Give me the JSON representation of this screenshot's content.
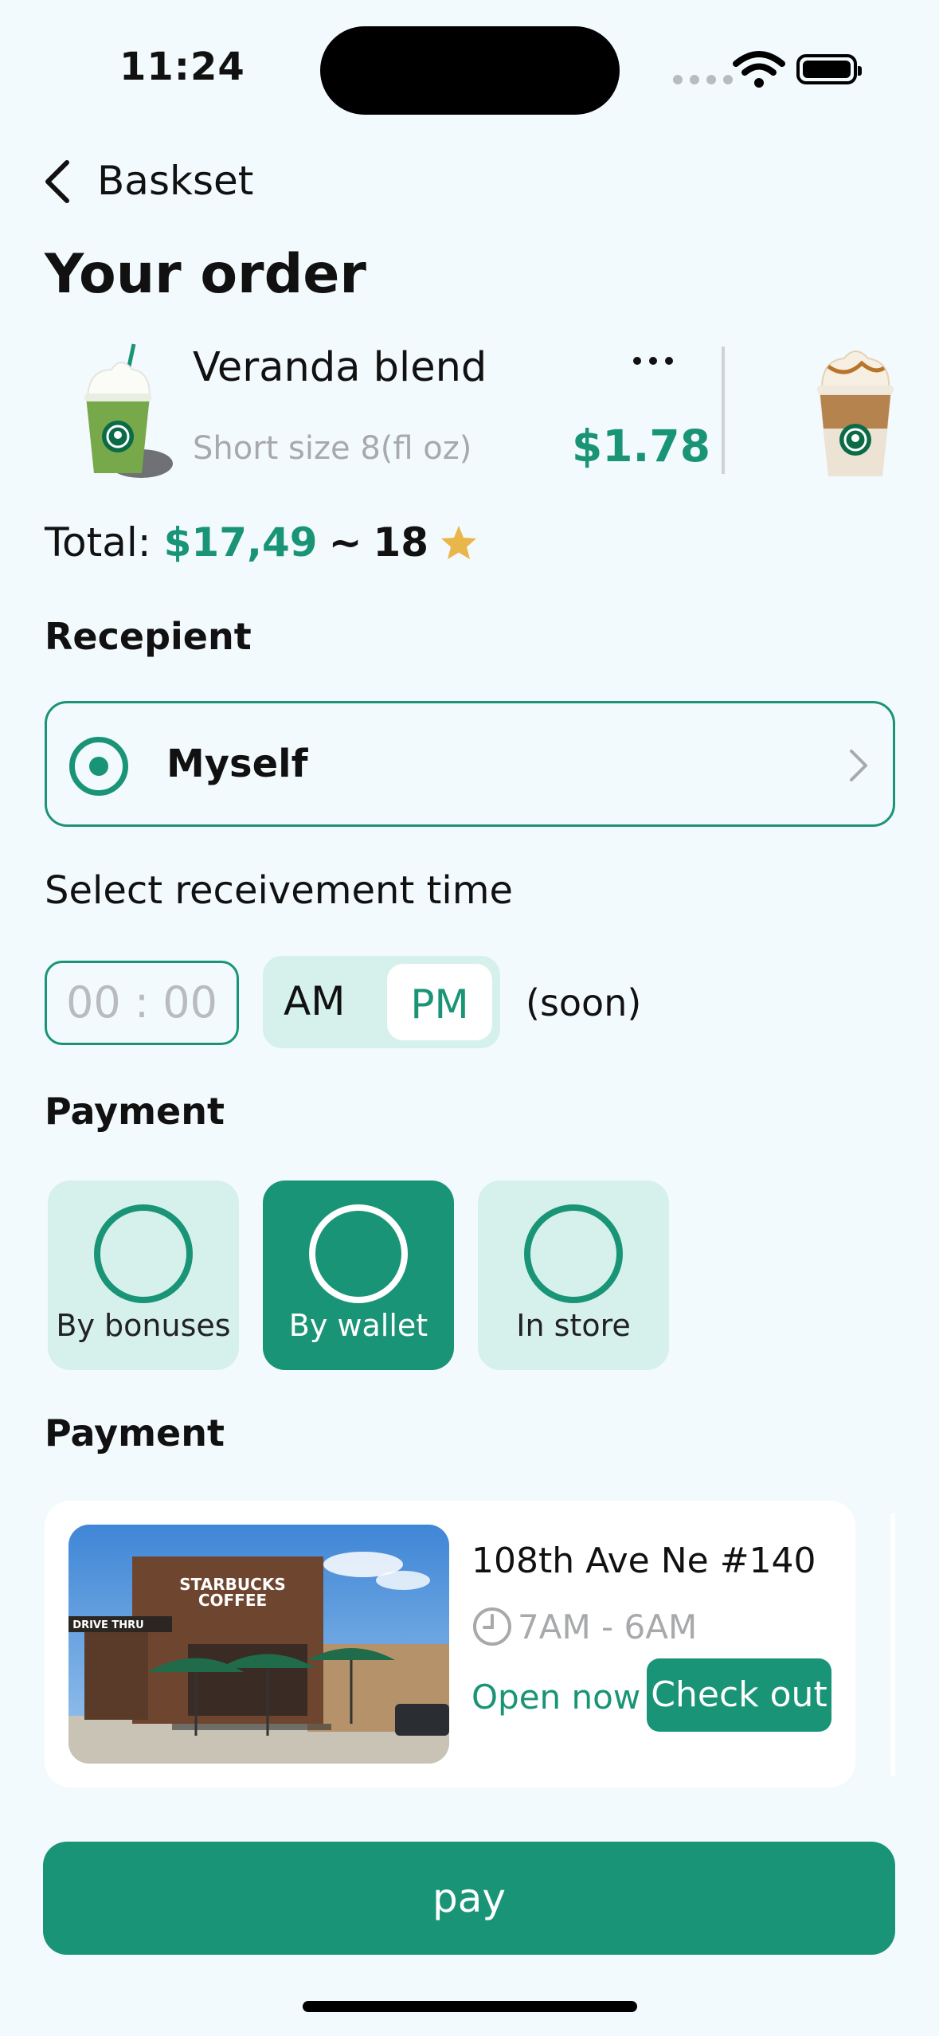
{
  "status_bar": {
    "time": "11:24"
  },
  "header": {
    "back_label": "Baskset",
    "title": "Your order"
  },
  "order": {
    "items": [
      {
        "name": "Veranda blend",
        "size": "Short size 8(fl oz)",
        "price": "$1.78"
      }
    ],
    "total_label": "Total:",
    "total_amount": "$17,49",
    "total_separator": "~",
    "total_stars": "18"
  },
  "recipient": {
    "section_title": "Recepient",
    "selected": "Myself"
  },
  "time_selection": {
    "label": "Select receivement time",
    "placeholder": "00 : 00",
    "am_label": "AM",
    "pm_label": "PM",
    "selected_period": "PM",
    "note": "(soon)"
  },
  "payment": {
    "section_title": "Payment",
    "options": [
      {
        "label": "By bonuses",
        "selected": false
      },
      {
        "label": "By wallet",
        "selected": true
      },
      {
        "label": "In store",
        "selected": false
      }
    ]
  },
  "store": {
    "section_title": "Payment",
    "address": "108th Ave Ne #140",
    "hours": "7AM - 6AM",
    "status": "Open now",
    "checkout_label": "Check out",
    "sign_line1": "STARBUCKS",
    "sign_line2": "COFFEE",
    "drive_thru": "DRIVE THRU"
  },
  "pay_button": {
    "label": "pay"
  },
  "colors": {
    "accent": "#1a9476",
    "accent_light": "#d6f1ec",
    "background": "#f3fafd",
    "star": "#e8b64a"
  }
}
